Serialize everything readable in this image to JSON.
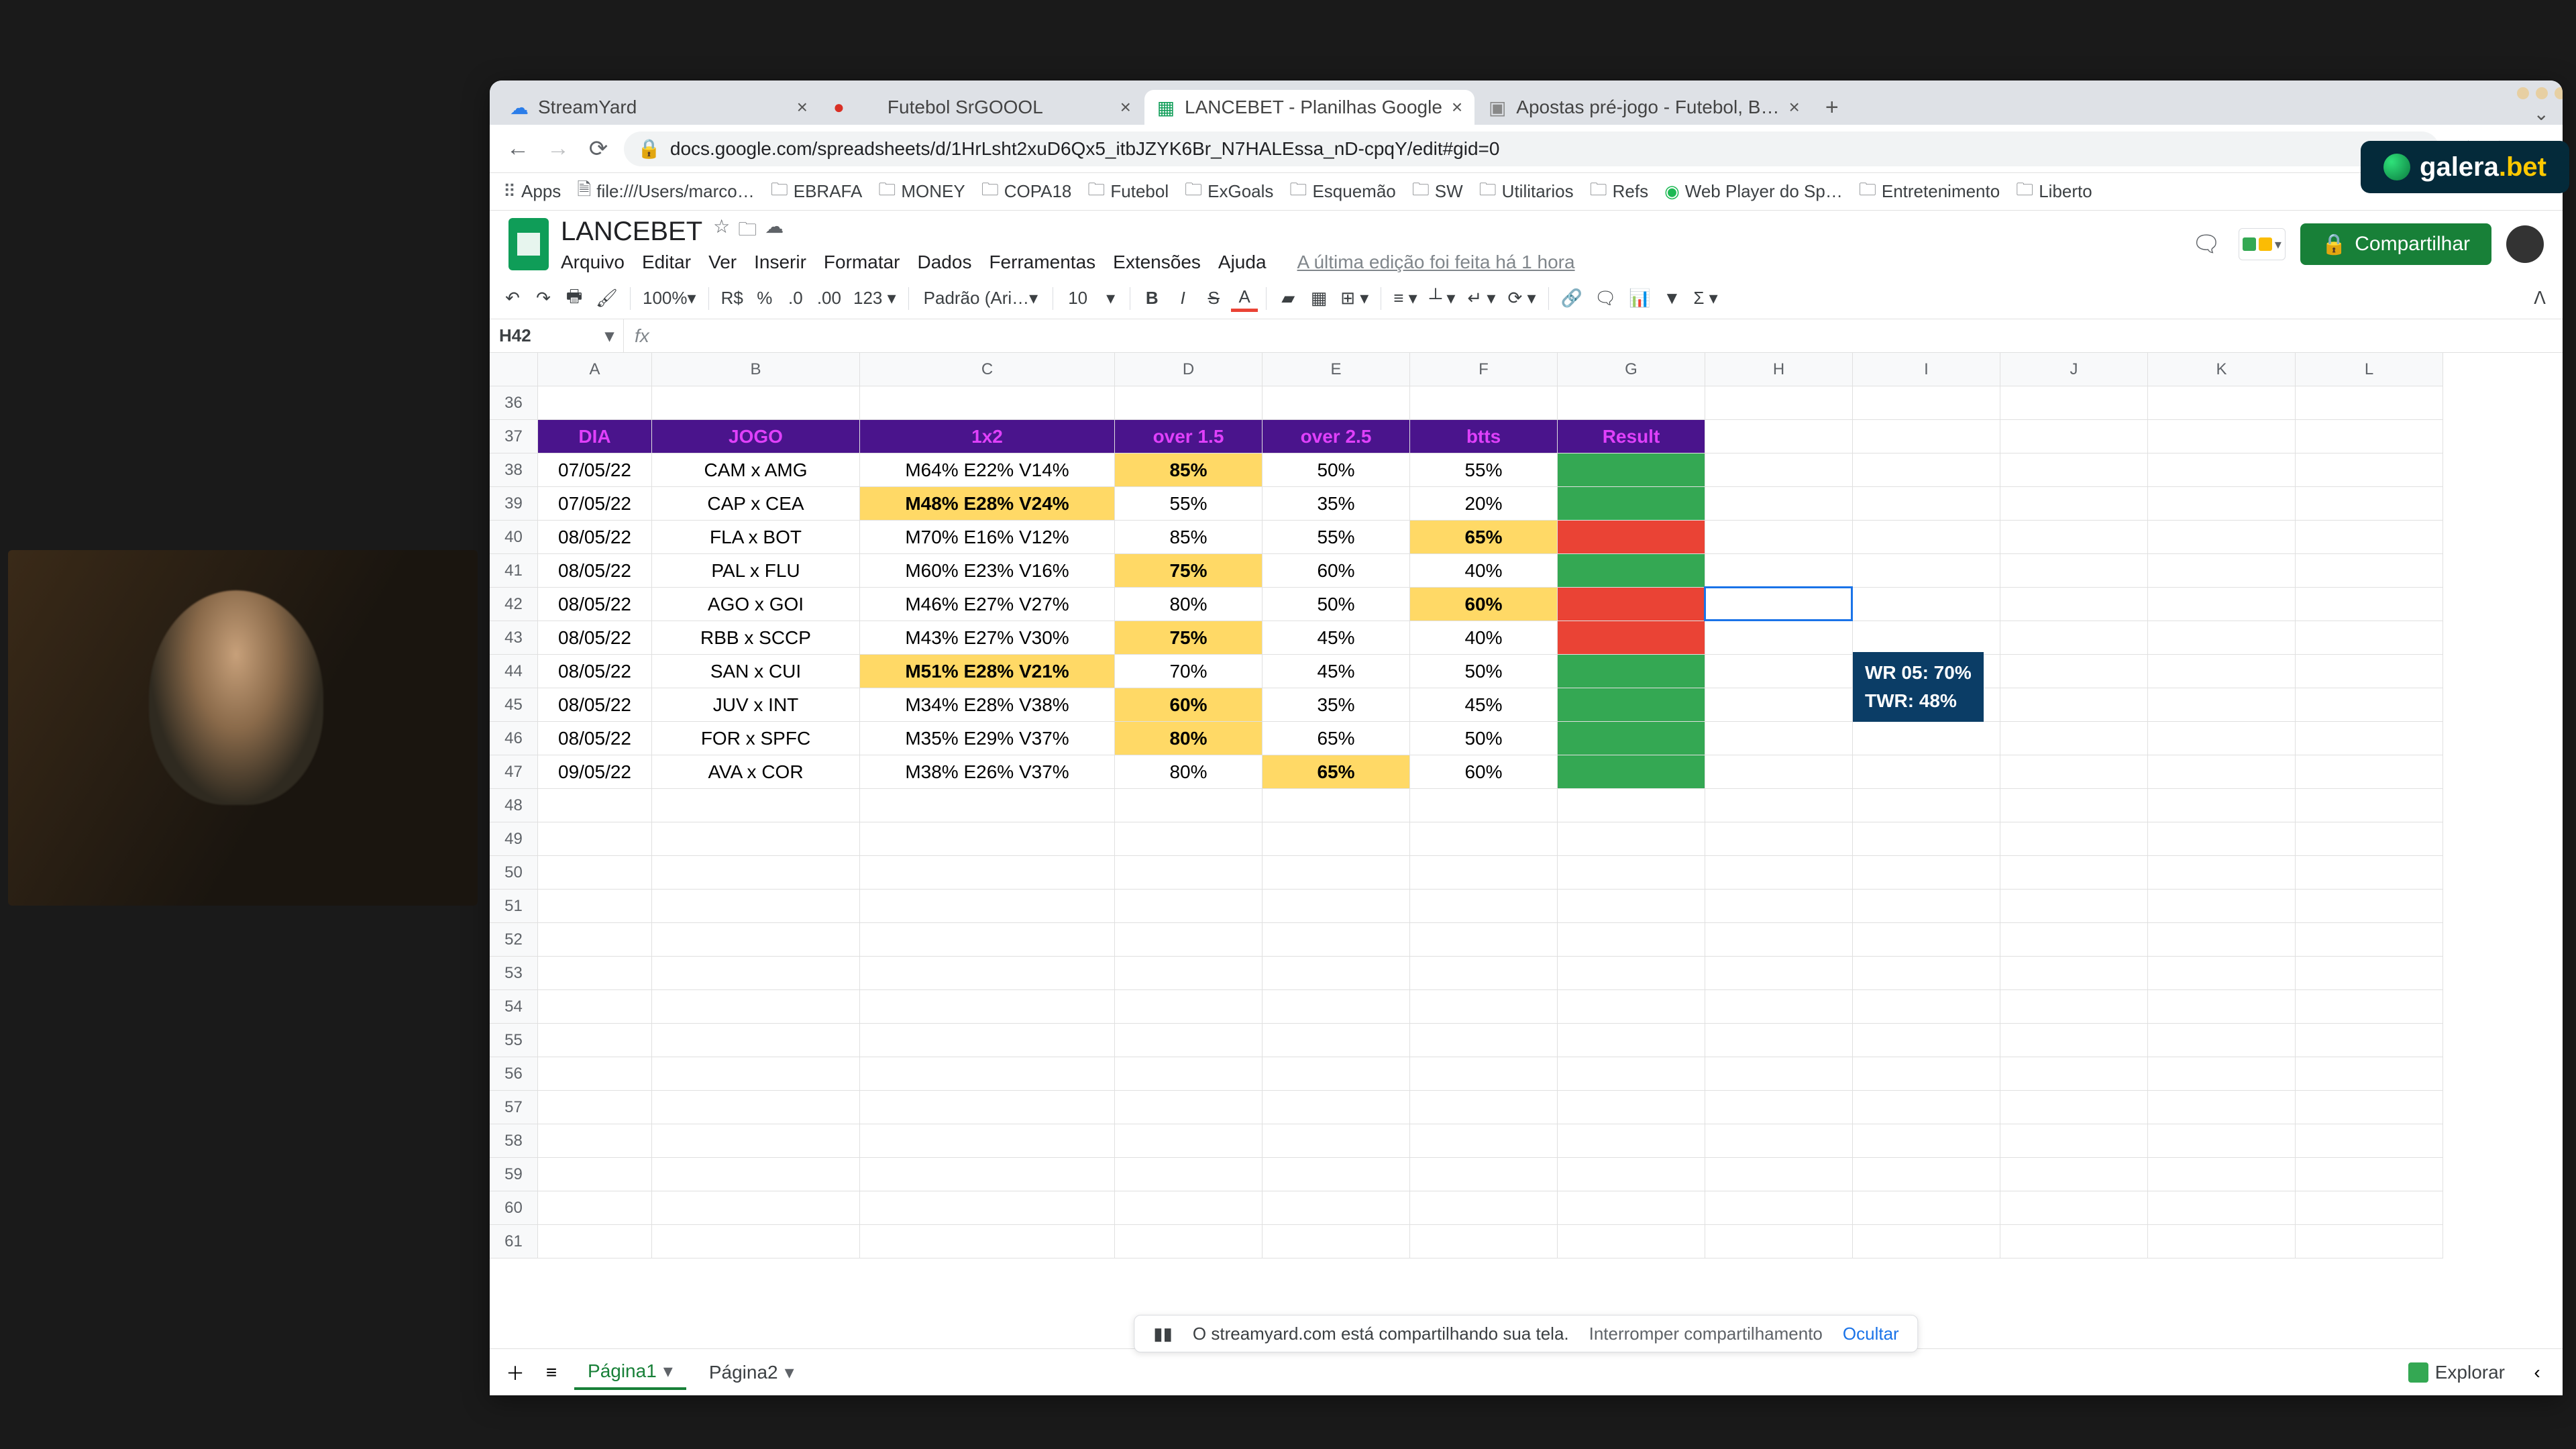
{
  "browser": {
    "tabs": [
      {
        "title": "StreamYard",
        "recording": false
      },
      {
        "title": "Futebol SrGOOOL",
        "recording": true
      },
      {
        "title": "LANCEBET - Planilhas Google",
        "recording": false,
        "active": true
      },
      {
        "title": "Apostas pré-jogo - Futebol, B…",
        "recording": false
      }
    ],
    "url": "docs.google.com/spreadsheets/d/1HrLsht2xuD6Qx5_itbJZYK6Br_N7HALEssa_nD-cpqY/edit#gid=0",
    "bookmarks": [
      "Apps",
      "file:///Users/marco…",
      "EBRAFA",
      "MONEY",
      "COPA18",
      "Futebol",
      "ExGoals",
      "Esquemão",
      "SW",
      "Utilitarios",
      "Refs",
      "Web Player do Sp…",
      "Entretenimento",
      "Liberto"
    ]
  },
  "sheets": {
    "doc_name": "LANCEBET",
    "menus": [
      "Arquivo",
      "Editar",
      "Ver",
      "Inserir",
      "Formatar",
      "Dados",
      "Ferramentas",
      "Extensões",
      "Ajuda"
    ],
    "edit_info": "A última edição foi feita há 1 hora",
    "share_label": "Compartilhar",
    "toolbar": {
      "zoom": "100%",
      "currency": "R$",
      "font": "Padrão (Ari…",
      "fontsize": "10"
    },
    "namebox": "H42",
    "fx": "",
    "columns": [
      "",
      "A",
      "B",
      "C",
      "D",
      "E",
      "F",
      "G",
      "H",
      "I",
      "J",
      "K",
      "L"
    ],
    "row_start": 36,
    "row_end": 61,
    "header_row": {
      "dia": "DIA",
      "jogo": "JOGO",
      "odds": "1x2",
      "o15": "over 1.5",
      "o25": "over 2.5",
      "btts": "btts",
      "result": "Result"
    },
    "rows": [
      {
        "r": 38,
        "dia": "07/05/22",
        "jogo": "CAM x AMG",
        "odds": "M64% E22% V14%",
        "odds_y": false,
        "o15": "85%",
        "o15_y": true,
        "o25": "50%",
        "o25_y": false,
        "btts": "55%",
        "btts_y": false,
        "result": "green"
      },
      {
        "r": 39,
        "dia": "07/05/22",
        "jogo": "CAP x CEA",
        "odds": "M48% E28% V24%",
        "odds_y": true,
        "o15": "55%",
        "o15_y": false,
        "o25": "35%",
        "o25_y": false,
        "btts": "20%",
        "btts_y": false,
        "result": "green"
      },
      {
        "r": 40,
        "dia": "08/05/22",
        "jogo": "FLA x BOT",
        "odds": "M70% E16% V12%",
        "odds_y": false,
        "o15": "85%",
        "o15_y": false,
        "o25": "55%",
        "o25_y": false,
        "btts": "65%",
        "btts_y": true,
        "result": "red"
      },
      {
        "r": 41,
        "dia": "08/05/22",
        "jogo": "PAL x FLU",
        "odds": "M60% E23% V16%",
        "odds_y": false,
        "o15": "75%",
        "o15_y": true,
        "o25": "60%",
        "o25_y": false,
        "btts": "40%",
        "btts_y": false,
        "result": "green"
      },
      {
        "r": 42,
        "dia": "08/05/22",
        "jogo": "AGO x GOI",
        "odds": "M46% E27% V27%",
        "odds_y": false,
        "o15": "80%",
        "o15_y": false,
        "o25": "50%",
        "o25_y": false,
        "btts": "60%",
        "btts_y": true,
        "result": "red"
      },
      {
        "r": 43,
        "dia": "08/05/22",
        "jogo": "RBB x SCCP",
        "odds": "M43% E27% V30%",
        "odds_y": false,
        "o15": "75%",
        "o15_y": true,
        "o25": "45%",
        "o25_y": false,
        "btts": "40%",
        "btts_y": false,
        "result": "red"
      },
      {
        "r": 44,
        "dia": "08/05/22",
        "jogo": "SAN x CUI",
        "odds": "M51% E28% V21%",
        "odds_y": true,
        "o15": "70%",
        "o15_y": false,
        "o25": "45%",
        "o25_y": false,
        "btts": "50%",
        "btts_y": false,
        "result": "green"
      },
      {
        "r": 45,
        "dia": "08/05/22",
        "jogo": "JUV x INT",
        "odds": "M34% E28% V38%",
        "odds_y": false,
        "o15": "60%",
        "o15_y": true,
        "o25": "35%",
        "o25_y": false,
        "btts": "45%",
        "btts_y": false,
        "result": "green"
      },
      {
        "r": 46,
        "dia": "08/05/22",
        "jogo": "FOR x SPFC",
        "odds": "M35% E29% V37%",
        "odds_y": false,
        "o15": "80%",
        "o15_y": true,
        "o25": "65%",
        "o25_y": false,
        "btts": "50%",
        "btts_y": false,
        "result": "green"
      },
      {
        "r": 47,
        "dia": "09/05/22",
        "jogo": "AVA x COR",
        "odds": "M38% E26% V37%",
        "odds_y": false,
        "o15": "80%",
        "o15_y": false,
        "o25": "65%",
        "o25_y": true,
        "btts": "60%",
        "btts_y": false,
        "result": "green"
      }
    ],
    "stats": {
      "line1": "WR 05: 70%",
      "line2": "TWR: 48%"
    },
    "sheet_tabs": [
      "Página1",
      "Página2"
    ],
    "explore": "Explorar"
  },
  "share_bar": {
    "msg": "O streamyard.com está compartilhando sua tela.",
    "stop": "Interromper compartilhamento",
    "hide": "Ocultar"
  },
  "brand": {
    "name": "galera",
    "suffix": ".bet"
  }
}
